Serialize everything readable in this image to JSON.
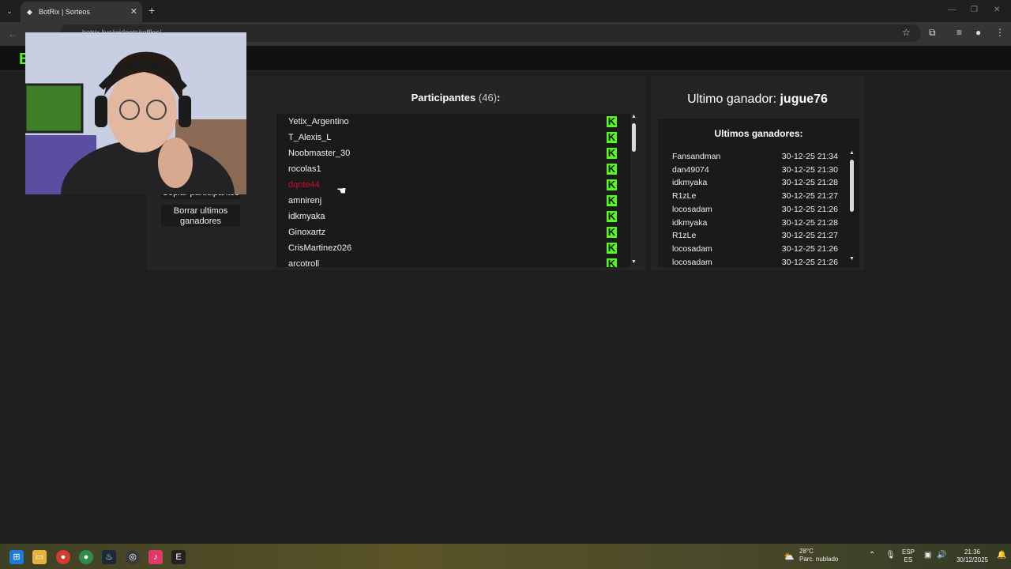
{
  "browser": {
    "tab_title": "BotRix | Sorteos",
    "tab_close": "✕",
    "new_tab": "+",
    "url": "botrix.live/widgets/raffles/"
  },
  "site": {
    "logo": "B"
  },
  "left_panel": {
    "copy_participants": "Copiar participantes",
    "clear_winners": "Borrar ultimos ganadores"
  },
  "participants": {
    "label": "Participantes",
    "count": "(46)",
    "colon": ":",
    "items": [
      "Yetix_Argentino",
      "T_Alexis_L",
      "Noobmaster_30",
      "rocolas1",
      "dqnte44",
      "amnirenj",
      "idkmyaka",
      "Ginoxartz",
      "CrisMartinez026",
      "arcotroll"
    ],
    "platform_icon": "kick-icon",
    "platform_letter": "K"
  },
  "last_winner": {
    "label": "Ultimo ganador:",
    "name": "jugue76"
  },
  "recent_winners": {
    "title": "Ultimos ganadores:",
    "rows": [
      {
        "name": "Fansandman",
        "time": "30-12-25 21:34"
      },
      {
        "name": "dan49074",
        "time": "30-12-25 21:30"
      },
      {
        "name": "idkmyaka",
        "time": "30-12-25 21:28"
      },
      {
        "name": "R1zLe",
        "time": "30-12-25 21:27"
      },
      {
        "name": "locosadam",
        "time": "30-12-25 21:26"
      },
      {
        "name": "idkmyaka",
        "time": "30-12-25 21:28"
      },
      {
        "name": "R1zLe",
        "time": "30-12-25 21:27"
      },
      {
        "name": "locosadam",
        "time": "30-12-25 21:26"
      },
      {
        "name": "locosadam",
        "time": "30-12-25 21:26"
      }
    ]
  },
  "taskbar": {
    "weather_temp": "28°C",
    "weather_desc": "Parc. nublado",
    "lang_top": "ESP",
    "lang_bottom": "ES",
    "time": "21:36",
    "date": "30/12/2025"
  },
  "colors": {
    "kick_green": "#53fc18",
    "highlight_red": "#c8102e"
  }
}
